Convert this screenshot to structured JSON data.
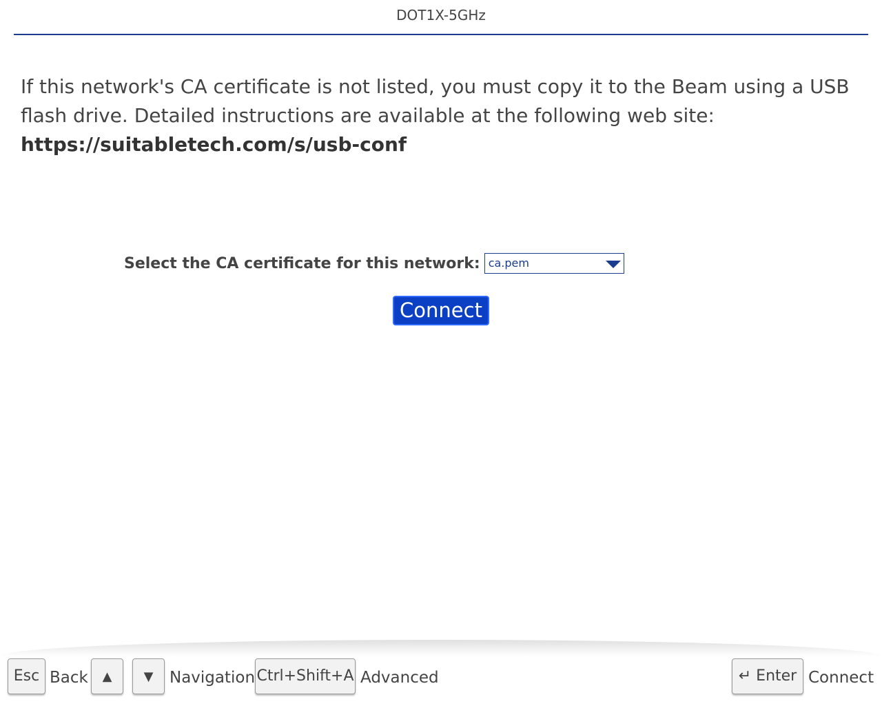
{
  "header": {
    "title": "DOT1X-5GHz"
  },
  "main": {
    "instruction_text": "If this network's CA certificate is not listed, you must copy it to the Beam using a USB flash drive. Detailed instructions are available at the following web site:",
    "instruction_url": "https://suitabletech.com/s/usb-conf",
    "ca_label": "Select the CA certificate for this network:",
    "ca_selected": "ca.pem",
    "connect_label": "Connect"
  },
  "footer": {
    "keys": [
      {
        "key": "Esc",
        "label": "Back"
      },
      {
        "key": "▲",
        "label": ""
      },
      {
        "key": "▼",
        "label": "Navigation"
      },
      {
        "key": "Ctrl+Shift+A",
        "label": "Advanced"
      },
      {
        "key": "↵ Enter",
        "label": "Connect"
      }
    ]
  },
  "colors": {
    "accent": "#1a3d8f",
    "button_bg": "#0b3fc4",
    "text": "#444444"
  }
}
